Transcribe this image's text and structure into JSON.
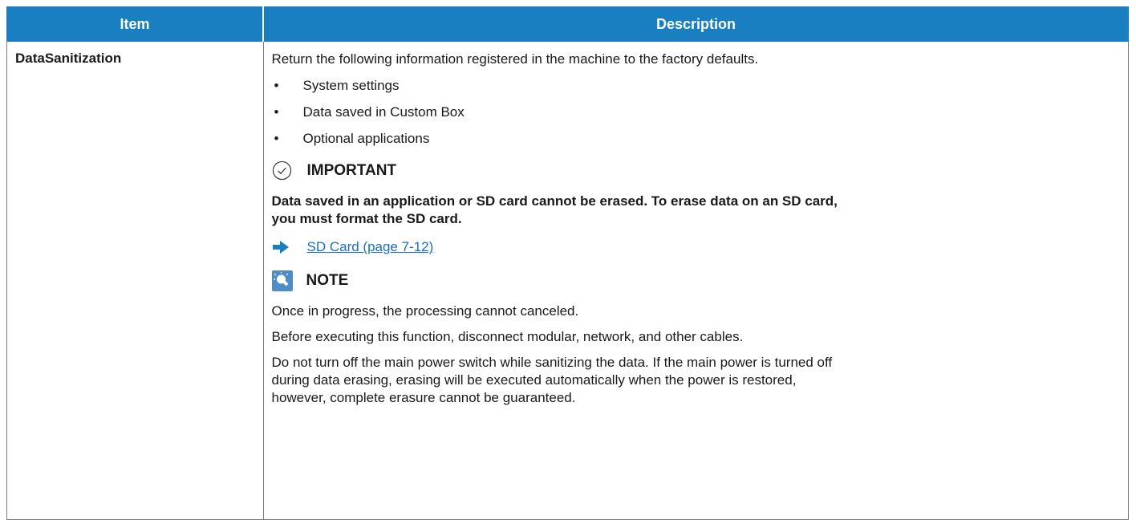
{
  "table": {
    "header": {
      "item": "Item",
      "description": "Description"
    },
    "row": {
      "item": "DataSanitization",
      "intro": "Return the following information registered in the machine to the factory defaults.",
      "bullets": [
        "System settings",
        "Data saved in Custom Box",
        "Optional applications"
      ],
      "bullet_symbol": "•",
      "important": {
        "icon": "check-circle-icon",
        "label": "IMPORTANT",
        "text_line1": "Data saved in an application or SD card cannot be erased. To erase data on an SD card,",
        "text_line2": "you must format the SD card."
      },
      "link": {
        "icon": "arrow-right-icon",
        "label": "SD Card (page 7-12)"
      },
      "note": {
        "icon": "lightbulb-icon",
        "label": "NOTE",
        "p1": "Once in progress, the processing cannot canceled.",
        "p2": "Before executing this function, disconnect modular, network, and other cables.",
        "p3_l1": "Do not turn off the main power switch while sanitizing the data. If the main power is turned off",
        "p3_l2": "during data erasing, erasing will be executed automatically when the power is restored,",
        "p3_l3": "however, complete erasure cannot be guaranteed."
      }
    }
  },
  "colors": {
    "header_bg": "#1a7fc1",
    "link": "#1a6fc4",
    "accent": "#1a7fc1"
  }
}
